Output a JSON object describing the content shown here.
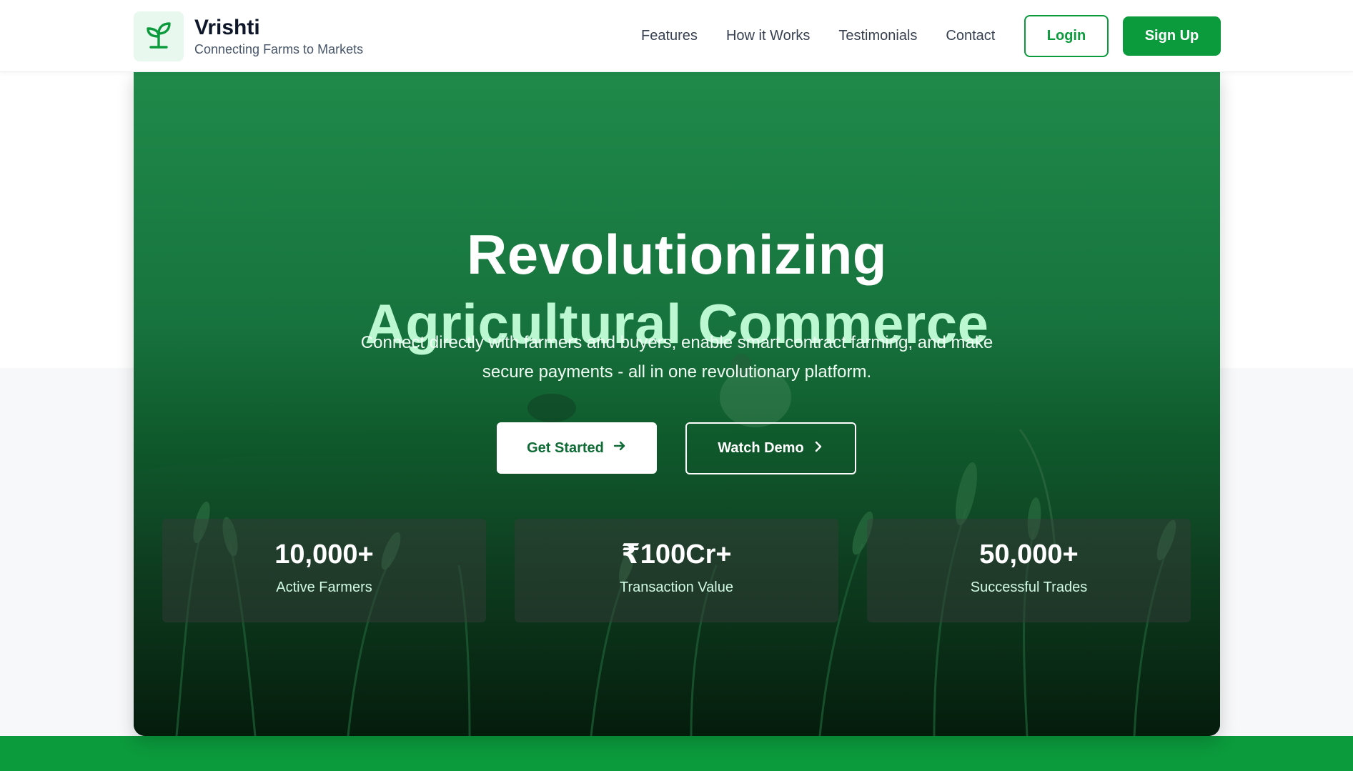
{
  "brand": {
    "name": "Vrishti",
    "tagline": "Connecting Farms to Markets",
    "logo_icon": "sprout-icon"
  },
  "nav": {
    "items": [
      "Features",
      "How it Works",
      "Testimonials",
      "Contact"
    ],
    "login_label": "Login",
    "signup_label": "Sign Up"
  },
  "hero": {
    "title_line1": "Revolutionizing",
    "title_line2": "Agricultural Commerce",
    "subtitle_line1": "Connect directly with farmers and buyers, enable smart contract farming, and make",
    "subtitle_line2": "secure payments - all in one revolutionary platform.",
    "get_started_label": "Get Started",
    "get_started_icon": "arrow-right-icon",
    "watch_demo_label": "Watch Demo",
    "watch_demo_icon": "chevron-right-icon"
  },
  "stats": [
    {
      "value": "10,000+",
      "label": "Active Farmers"
    },
    {
      "value": "₹100Cr+",
      "label": "Transaction Value"
    },
    {
      "value": "50,000+",
      "label": "Successful Trades"
    }
  ],
  "colors": {
    "brand_green": "#0b9a3c",
    "hero_green": "#1f8a4a",
    "accent_mint": "#bbf7d0"
  }
}
